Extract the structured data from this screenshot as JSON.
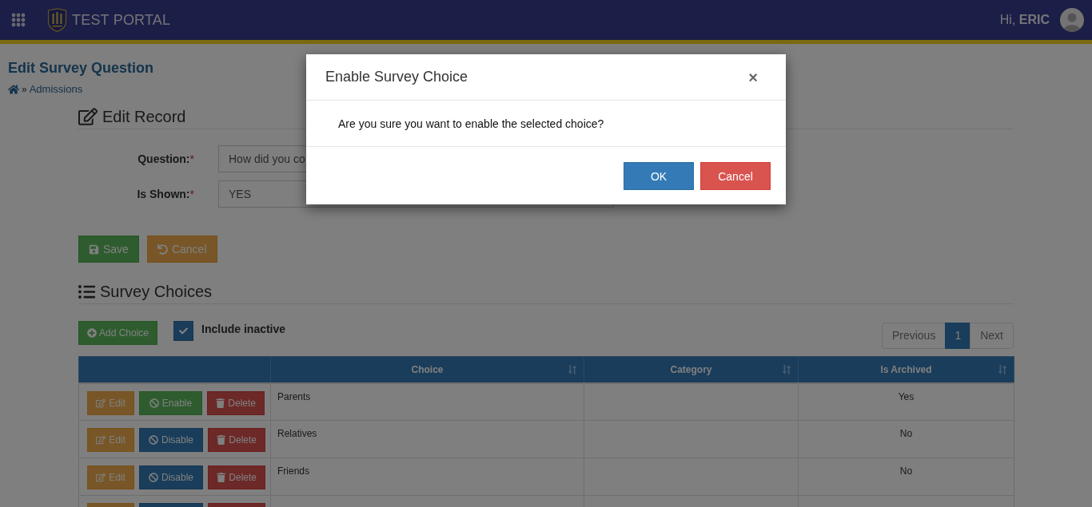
{
  "top_bar": {
    "app_title": "TEST PORTAL",
    "greeting": "Hi, **ERIC**"
  },
  "page": {
    "title": "Edit Survey Question",
    "breadcrumb": {
      "separator": "»",
      "link": "Admissions"
    }
  },
  "edit_record": {
    "heading": "Edit Record",
    "fields": [
      {
        "label": "Question:",
        "required_mark": "*",
        "value": "How did you co"
      },
      {
        "label": "Is Shown:",
        "required_mark": "*",
        "value": "YES"
      }
    ],
    "buttons": [
      {
        "kind": "save",
        "label": "Save"
      },
      {
        "kind": "cancel",
        "label": "Cancel"
      }
    ]
  },
  "survey_choices": {
    "heading": "Survey Choices",
    "add_button": "Add Choice",
    "include_inactive": {
      "label": "Include inactive",
      "checked": true
    },
    "pagination": {
      "previous": "Previous",
      "pages": [
        {
          "label": "1",
          "selected": true
        }
      ],
      "next": "Next"
    },
    "table": {
      "columns": [
        {
          "kind": "actions"
        },
        {
          "kind": "sortable",
          "label": "Choice"
        },
        {
          "kind": "sortable",
          "label": "Category"
        },
        {
          "kind": "sortable",
          "label": "Is Archived"
        }
      ],
      "rows": [
        {
          "actions": [
            {
              "kind": "edit",
              "label": "Edit"
            },
            {
              "kind": "enable",
              "label": "Enable"
            },
            {
              "kind": "delete",
              "label": "Delete"
            }
          ],
          "choice": "Parents",
          "is_archived": "Yes"
        },
        {
          "actions": [
            {
              "kind": "edit",
              "label": "Edit"
            },
            {
              "kind": "disable",
              "label": "Disable"
            },
            {
              "kind": "delete",
              "label": "Delete"
            }
          ],
          "choice": "Relatives",
          "is_archived": "No"
        },
        {
          "actions": [
            {
              "kind": "edit",
              "label": "Edit"
            },
            {
              "kind": "disable",
              "label": "Disable"
            },
            {
              "kind": "delete",
              "label": "Delete"
            }
          ],
          "choice": "Friends",
          "is_archived": "No"
        },
        {
          "actions": [
            {
              "kind": "edit"
            },
            {
              "kind": "disable"
            },
            {
              "kind": "delete"
            }
          ]
        }
      ]
    }
  },
  "modal": {
    "title": "Enable Survey Choice",
    "close": "×",
    "message": "Are you sure you want to enable the selected choice?",
    "buttons": [
      {
        "kind": "primary",
        "label": "OK"
      },
      {
        "kind": "danger",
        "label": "Cancel"
      }
    ]
  }
}
